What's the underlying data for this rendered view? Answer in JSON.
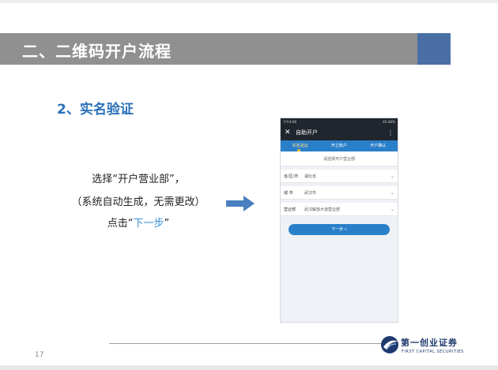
{
  "slide": {
    "title": "二、二维码开户流程",
    "section": "2、实名验证",
    "instruction": {
      "line1": "选择“开户营业部”，",
      "line2": "（系统自动生成，无需更改）",
      "line3_prefix": "点击“",
      "line3_link": "下一步",
      "line3_suffix": "”"
    },
    "page_number": "17",
    "logo": {
      "name": "第一创业证券",
      "subtitle": "FIRST CAPITAL SECURITIES"
    },
    "colors": {
      "title_bar": "#909090",
      "title_accent": "#4a6fa5",
      "section_text": "#2a70b8",
      "arrow": "#4a7fc0",
      "app_blue": "#2a7fc9"
    }
  },
  "phone": {
    "status_left": "下午4:08",
    "status_right": "4G 84%",
    "app_title": "自助开户",
    "tabs": [
      "实名验证",
      "开立账户",
      "开户确认"
    ],
    "active_tab": 0,
    "select_title": "请选择开户营业部",
    "rows": [
      {
        "label": "省/区/市",
        "value": "湖北省"
      },
      {
        "label": "城  市",
        "value": "武汉市"
      },
      {
        "label": "营业部",
        "value": "武汉解放大道营业部"
      }
    ],
    "next_button": "下一步 »"
  }
}
